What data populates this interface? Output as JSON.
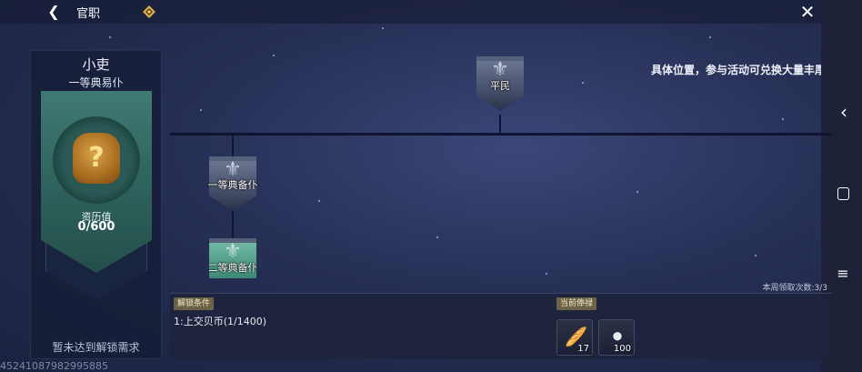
{
  "header": {
    "title": "官职"
  },
  "rank_card": {
    "rank_name": "小吏",
    "rank_sub": "一等典易仆",
    "xp_label": "资历值",
    "xp_value": "0/600",
    "locked_text": "暂未达到解锁需求"
  },
  "announcement": "具体位置，参与活动可兑换大量丰厚奖",
  "tree": {
    "nodes": [
      {
        "label": "平民",
        "style": "grey"
      },
      {
        "label": "一等典备仆",
        "style": "grey"
      },
      {
        "label": "二等典备仆",
        "style": "teal"
      }
    ]
  },
  "bottom": {
    "weekly_claims": "本周领取次数:3/3",
    "unlock_tag": "解锁条件",
    "condition": "1:上交贝币(1/1400)",
    "salary_tag": "当前俸禄",
    "rewards": [
      {
        "icon": "bread-icon",
        "count": "17"
      },
      {
        "icon": "pellets-icon",
        "count": "100"
      }
    ]
  },
  "footer_id": "452410879829958​85"
}
